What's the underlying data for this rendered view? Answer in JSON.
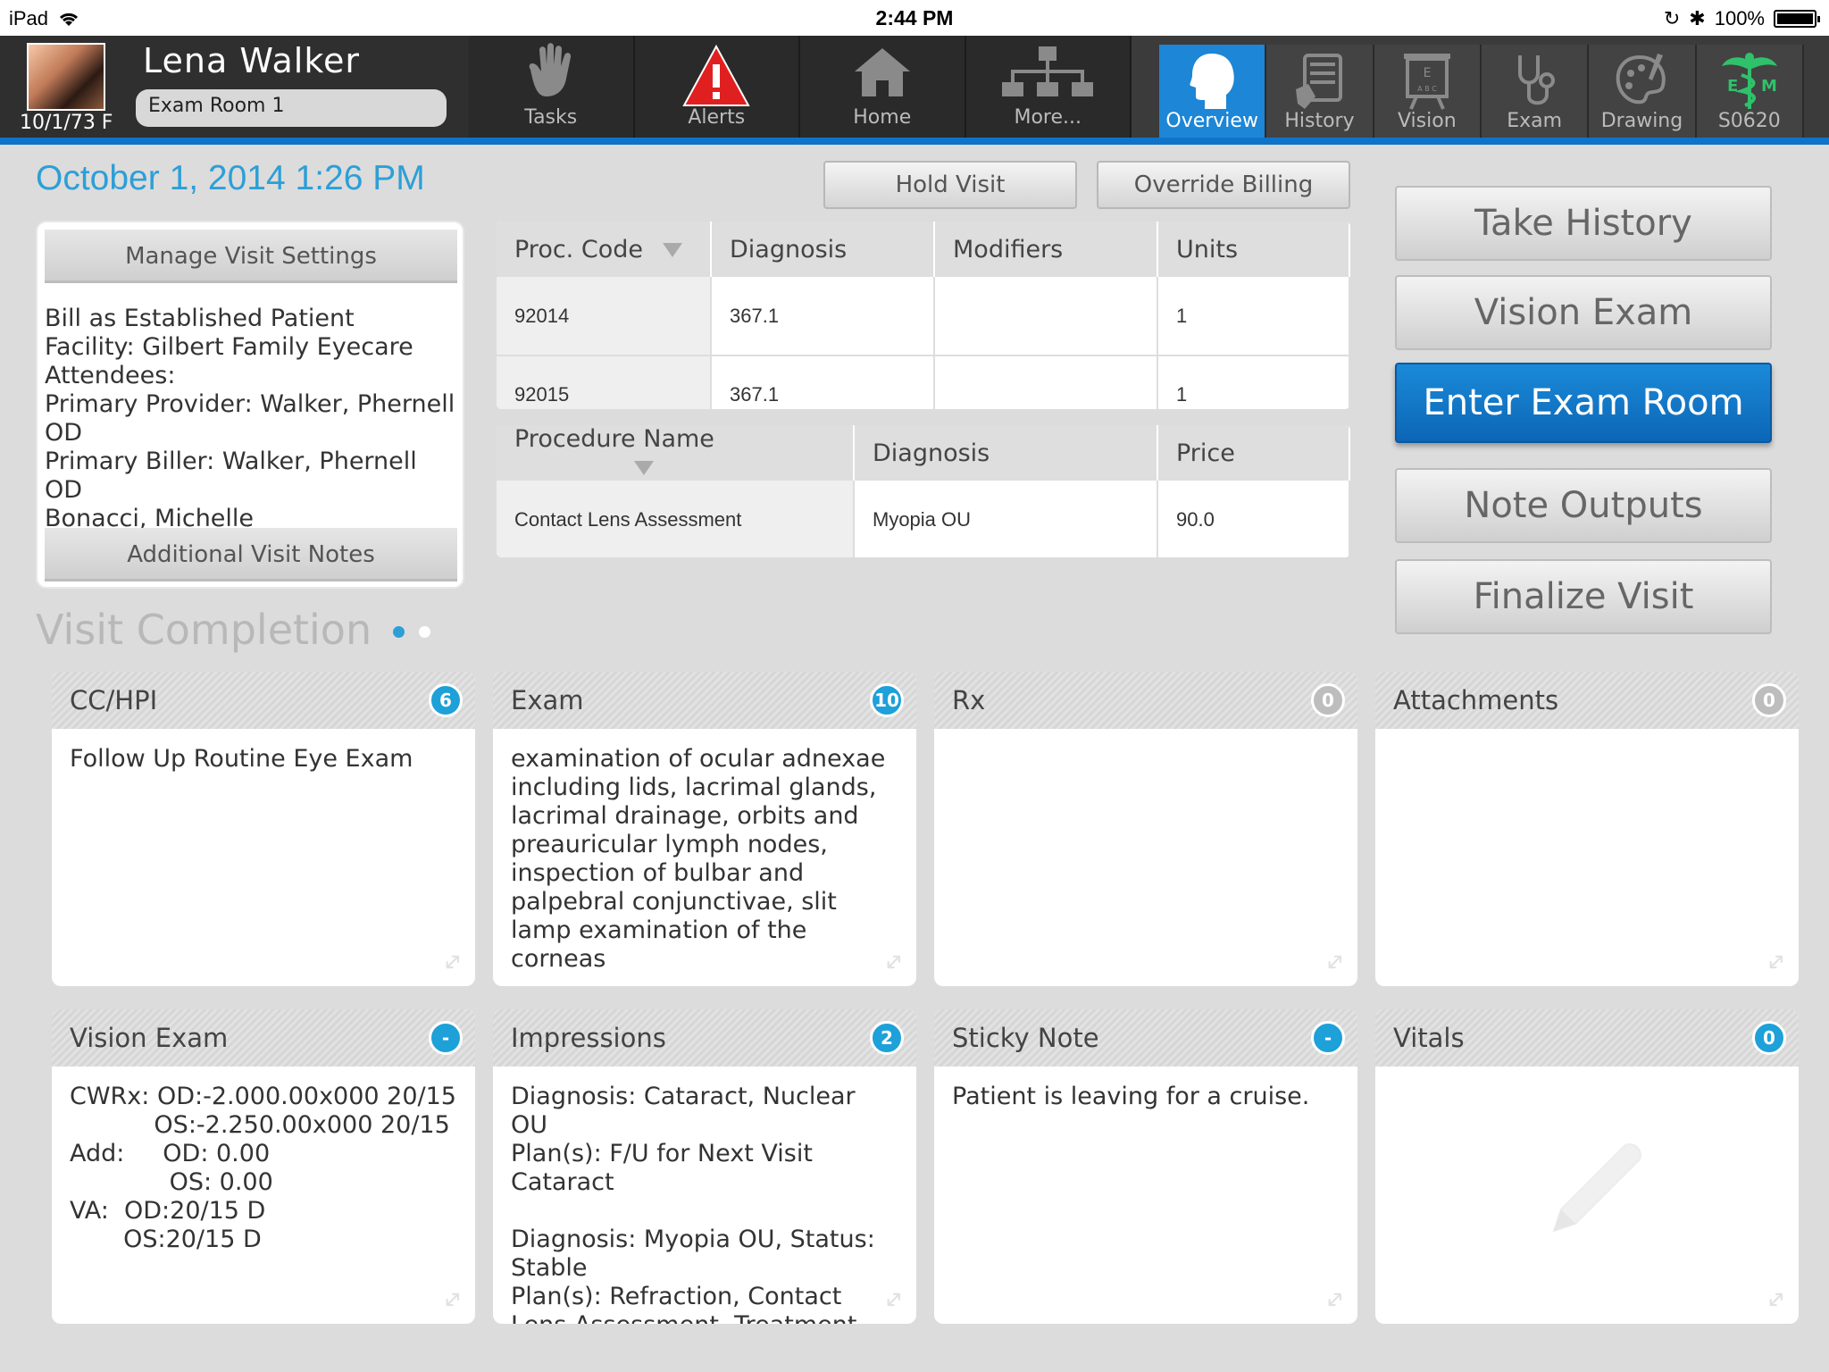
{
  "status_bar": {
    "device": "iPad",
    "time": "2:44 PM",
    "battery": "100%"
  },
  "patient": {
    "name": "Lena  Walker",
    "dob": "10/1/73 F",
    "room": "Exam Room 1"
  },
  "nav": [
    {
      "label": "Tasks",
      "icon": "hand-icon"
    },
    {
      "label": "Alerts",
      "icon": "alert-icon"
    },
    {
      "label": "Home",
      "icon": "home-icon"
    },
    {
      "label": "More...",
      "icon": "sitemap-icon"
    }
  ],
  "tabs": [
    {
      "label": "Overview",
      "icon": "head-icon",
      "active": true
    },
    {
      "label": "History",
      "icon": "tablet-icon"
    },
    {
      "label": "Vision",
      "icon": "eye-chart-icon"
    },
    {
      "label": "Exam",
      "icon": "stethoscope-icon"
    },
    {
      "label": "Drawing",
      "icon": "palette-icon"
    },
    {
      "label": "S0620",
      "icon": "caduceus-icon",
      "logo_letters": [
        "E",
        "M"
      ]
    }
  ],
  "visit_datetime": "October 1, 2014 1:26 PM",
  "actions": {
    "hold_visit": "Hold Visit",
    "override_billing": "Override Billing"
  },
  "settings": {
    "manage_label": "Manage Visit Settings",
    "lines": [
      "Bill as Established Patient",
      "Facility: Gilbert Family Eyecare",
      "Attendees:",
      "Primary Provider: Walker, Phernell OD",
      "Primary Biller: Walker, Phernell OD",
      "Bonacci, Michelle"
    ],
    "notes_label": "Additional Visit Notes"
  },
  "proc_table": {
    "headers": [
      "Proc. Code",
      "Diagnosis",
      "Modifiers",
      "Units"
    ],
    "rows": [
      [
        "92014",
        "367.1",
        "",
        "1"
      ],
      [
        "92015",
        "367.1",
        "",
        "1"
      ]
    ]
  },
  "procname_table": {
    "headers": [
      "Procedure Name",
      "Diagnosis",
      "Price"
    ],
    "rows": [
      [
        "Contact Lens Assessment",
        "Myopia OU",
        "90.0"
      ]
    ]
  },
  "side_buttons": {
    "take_history": "Take History",
    "vision_exam": "Vision Exam",
    "enter_exam_room": "Enter Exam Room",
    "note_outputs": "Note Outputs",
    "finalize_visit": "Finalize Visit"
  },
  "completion": {
    "title": "Visit Completion",
    "cards": [
      {
        "title": "CC/HPI",
        "badge": "6",
        "body": "Follow Up Routine Eye Exam"
      },
      {
        "title": "Exam",
        "badge": "10",
        "body": "examination of ocular adnexae including lids, lacrimal glands, lacrimal drainage, orbits and preauricular lymph nodes, inspection of bulbar and palpebral conjunctivae, slit lamp examination of the corneas"
      },
      {
        "title": "Rx",
        "badge": "0",
        "body": ""
      },
      {
        "title": "Attachments",
        "badge": "0",
        "body": ""
      },
      {
        "title": "Vision Exam",
        "badge": "-",
        "body": "CWRx: OD:-2.000.00x000 20/15\n           OS:-2.250.00x000 20/15\nAdd:     OD: 0.00\n             OS: 0.00\nVA:  OD:20/15 D\n       OS:20/15 D"
      },
      {
        "title": "Impressions",
        "badge": "2",
        "body": "Diagnosis: Cataract, Nuclear OU\nPlan(s): F/U for Next Visit Cataract\n\nDiagnosis: Myopia OU, Status: Stable\nPlan(s): Refraction, Contact Lens Assessment, Treatment Regimen"
      },
      {
        "title": "Sticky Note",
        "badge": "-",
        "body": "Patient is leaving for a cruise."
      },
      {
        "title": "Vitals",
        "badge": "0",
        "body": ""
      }
    ]
  }
}
